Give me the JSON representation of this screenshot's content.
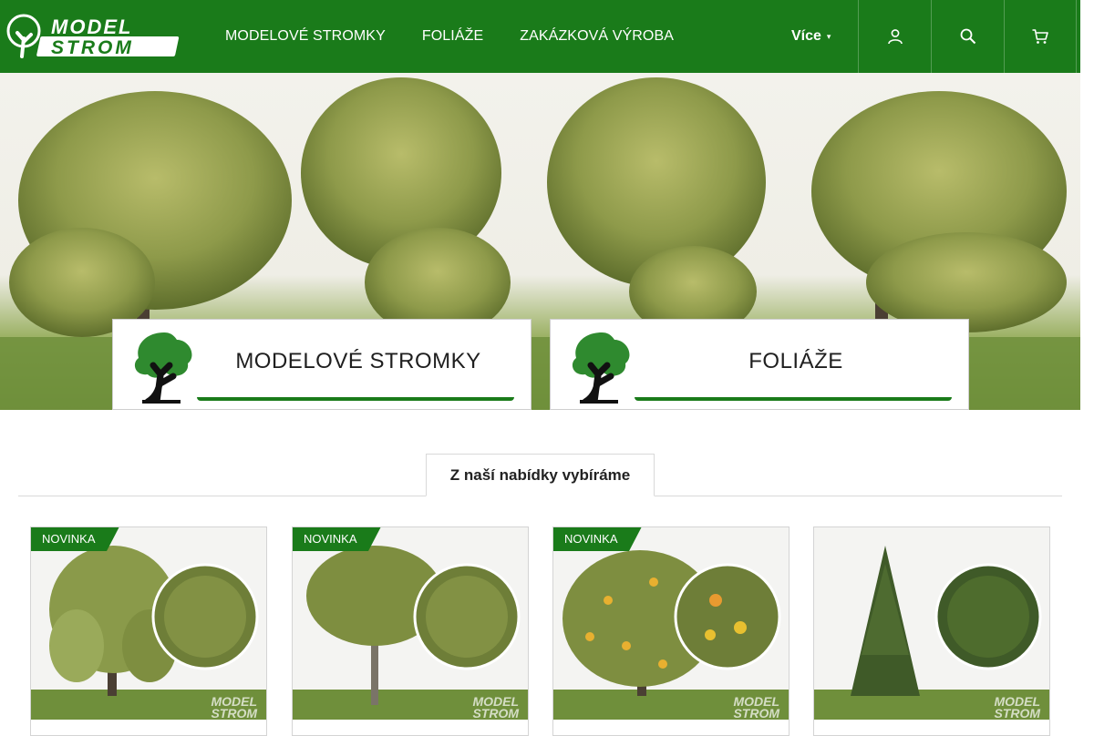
{
  "header": {
    "logo_text_1": "MODEL",
    "logo_text_2": "STROM",
    "nav": [
      "MODELOVÉ STROMKY",
      "FOLIÁŽE",
      "ZAKÁZKOVÁ VÝROBA"
    ],
    "more_label": "Více",
    "icons": [
      "user-icon",
      "search-icon",
      "cart-icon"
    ]
  },
  "hero": {
    "cards": [
      {
        "label": "MODELOVÉ STROMKY"
      },
      {
        "label": "FOLIÁŽE"
      }
    ]
  },
  "section": {
    "title": "Z naší nabídky vybíráme"
  },
  "products": [
    {
      "badge": "NOVINKA",
      "kind": "weeping-willow"
    },
    {
      "badge": "NOVINKA",
      "kind": "round-tree"
    },
    {
      "badge": "NOVINKA",
      "kind": "fruit-tree"
    },
    {
      "badge": "",
      "kind": "spruce"
    }
  ],
  "watermark": {
    "line1": "MODEL",
    "line2": "STROM"
  },
  "colors": {
    "brand_green": "#1a7b1a",
    "foliage": "#8a9a4a",
    "grass": "#6f8f3b"
  }
}
